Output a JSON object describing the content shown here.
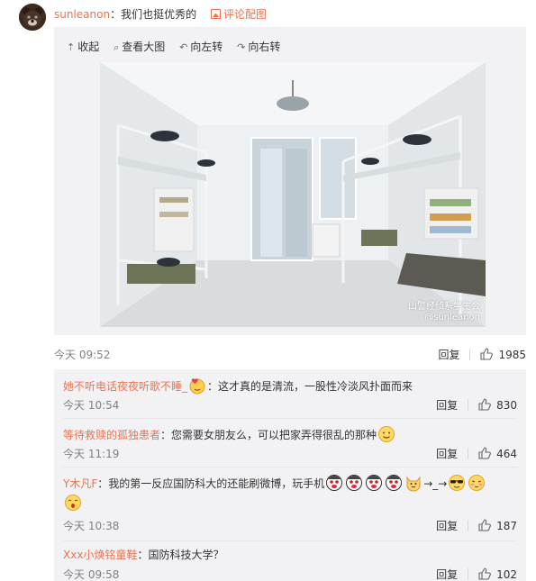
{
  "post": {
    "username": "sunleanon",
    "colon": "：",
    "text": "我们也挺优秀的",
    "pic_comment_label": "评论配图",
    "toolbar": {
      "collapse": "收起",
      "view_large": "查看大图",
      "rotate_left": "向左转",
      "rotate_right": "向右转"
    },
    "watermark_line1": "山警经侦系学生会",
    "watermark_line2": "@sunleanon",
    "time": "今天 09:52",
    "reply_label": "回复",
    "like_count": "1985"
  },
  "comments": [
    {
      "user": "她不听电话夜夜听歌不睡_",
      "body": "：这才真的是清流，一股性冷淡风扑面而来",
      "time": "今天 10:54",
      "reply_label": "回复",
      "like_count": "830"
    },
    {
      "user": "等待救赎的孤独患者",
      "body": "：您需要女朋友么，可以把家弄得很乱的那种",
      "time": "今天 11:19",
      "reply_label": "回复",
      "like_count": "464"
    },
    {
      "user": "Y木凡F",
      "body": "：我的第一反应国防科大的还能刷微博，玩手机",
      "arrow1": "→_→",
      "time": "今天 10:38",
      "reply_label": "回复",
      "like_count": "187"
    },
    {
      "user": "Xxx小焕铭童鞋",
      "body": "：国防科技大学？",
      "time": "今天 09:58",
      "reply_label": "回复",
      "like_count": "102"
    }
  ],
  "colors": {
    "link": "#eb7350",
    "panel_bg": "#f2f2f5",
    "time": "#808080"
  },
  "icons": [
    "bear-avatar",
    "picture-icon",
    "collapse-up-icon",
    "search-icon",
    "rotate-left-icon",
    "rotate-right-icon",
    "thumb-up-icon",
    "heart-face-emoji",
    "smile-emoji",
    "doge-emoji",
    "cat-emoji",
    "sunglasses-emoji",
    "blush-emoji",
    "love-face-emoji"
  ]
}
